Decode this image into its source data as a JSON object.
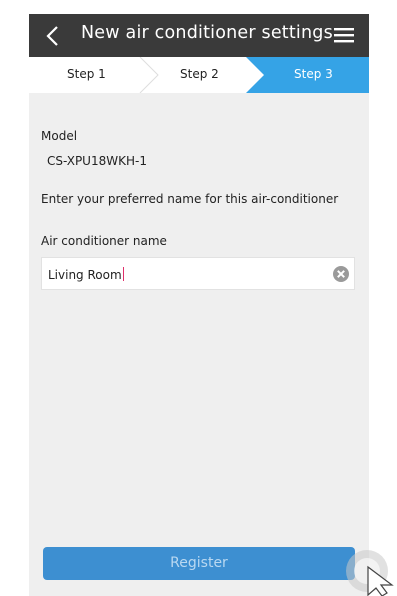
{
  "header": {
    "title": "New air conditioner settings",
    "back_icon": "chevron-left-icon",
    "menu_icon": "hamburger-menu-icon"
  },
  "steps": {
    "items": [
      {
        "label": "Step 1",
        "active": false
      },
      {
        "label": "Step 2",
        "active": false
      },
      {
        "label": "Step 3",
        "active": true
      }
    ],
    "active_color": "#35a3e6"
  },
  "model": {
    "label": "Model",
    "value": "CS-XPU18WKH-1"
  },
  "instruction": "Enter your preferred name for this air-conditioner",
  "name_field": {
    "label": "Air conditioner name",
    "value": "Living Room",
    "clear_icon": "clear-circle-icon"
  },
  "register_button": {
    "label": "Register",
    "color": "#3d8fd1"
  },
  "colors": {
    "header_bg": "#3a3a3a",
    "content_bg": "#efefef",
    "caret": "#e0306a"
  }
}
